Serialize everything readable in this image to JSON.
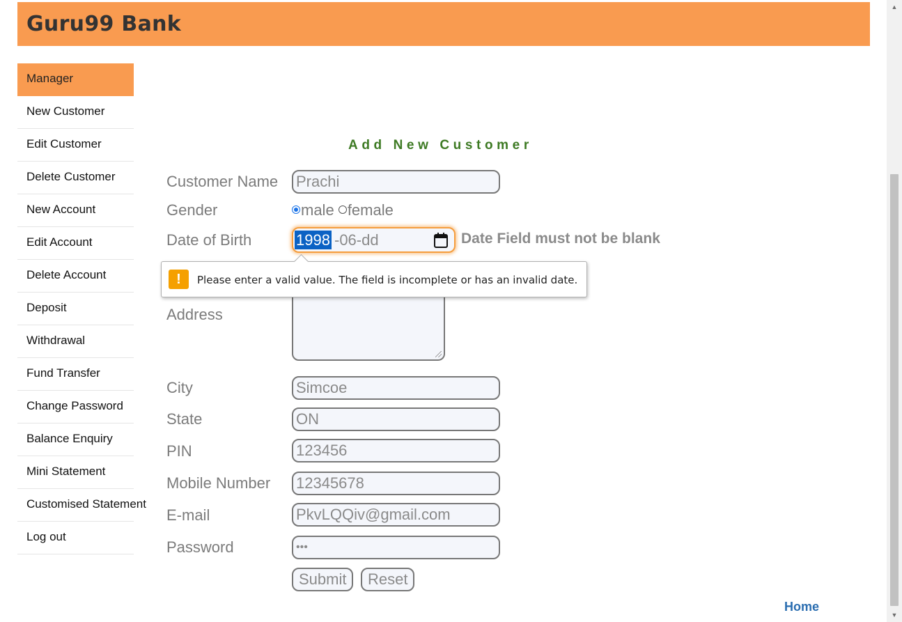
{
  "header": {
    "title": "Guru99 Bank"
  },
  "sidebar": {
    "items": [
      {
        "label": "Manager",
        "active": true
      },
      {
        "label": "New Customer"
      },
      {
        "label": "Edit Customer"
      },
      {
        "label": "Delete Customer"
      },
      {
        "label": "New Account"
      },
      {
        "label": "Edit Account"
      },
      {
        "label": "Delete Account"
      },
      {
        "label": "Deposit"
      },
      {
        "label": "Withdrawal"
      },
      {
        "label": "Fund Transfer"
      },
      {
        "label": "Change Password"
      },
      {
        "label": "Balance Enquiry"
      },
      {
        "label": "Mini Statement"
      },
      {
        "label": "Customised Statement"
      },
      {
        "label": "Log out"
      }
    ]
  },
  "form": {
    "title": "Add New Customer",
    "customer_name": {
      "label": "Customer Name",
      "value": "Prachi"
    },
    "gender": {
      "label": "Gender",
      "options": [
        "male",
        "female"
      ],
      "selected": "male"
    },
    "dob": {
      "label": "Date of Birth",
      "year": "1998",
      "rest": "-06-dd",
      "error": "Date Field must not be blank"
    },
    "tooltip": {
      "icon": "!",
      "message": "Please enter a valid value. The field is incomplete or has an invalid date."
    },
    "address": {
      "label": "Address",
      "value": ""
    },
    "city": {
      "label": "City",
      "value": "Simcoe"
    },
    "state": {
      "label": "State",
      "value": "ON"
    },
    "pin": {
      "label": "PIN",
      "value": "123456"
    },
    "mobile": {
      "label": "Mobile Number",
      "value": "12345678"
    },
    "email": {
      "label": "E-mail",
      "value": "PkvLQQiv@gmail.com"
    },
    "password": {
      "label": "Password",
      "value": "•••"
    },
    "submit_label": "Submit",
    "reset_label": "Reset"
  },
  "footer": {
    "home_link": "Home"
  },
  "colors": {
    "header_bg": "#f99b50",
    "title_green": "#3d7a23",
    "link_blue": "#2a6db0",
    "focus_orange": "#f59d3d",
    "selection_blue": "#0b62c4"
  },
  "icons": {
    "calendar": "calendar-icon",
    "warning": "warning-icon"
  }
}
